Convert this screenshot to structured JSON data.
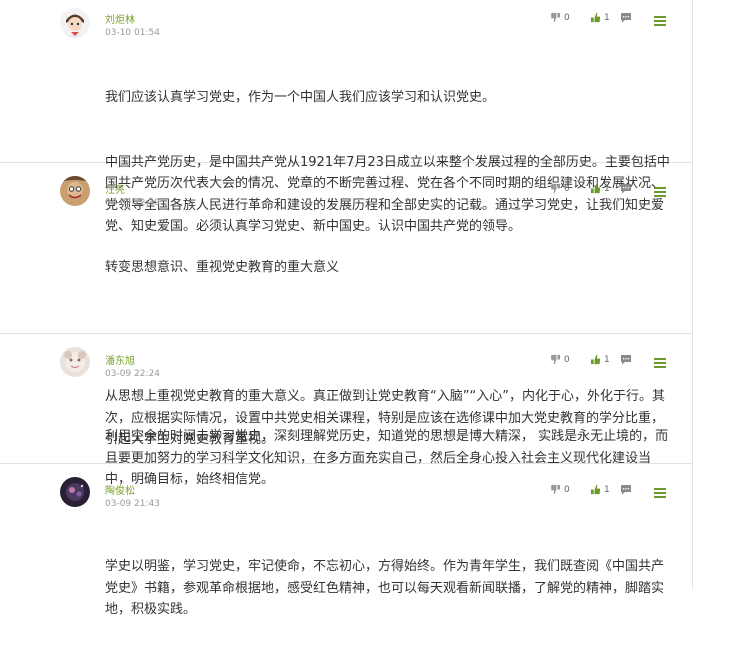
{
  "comments": [
    {
      "name": "刘炬林",
      "time": "03-10 01:54",
      "dislikes": "0",
      "likes": "1",
      "paragraphs": [
        "我们应该认真学习党史，作为一个中国人我们应该学习和认识党史。",
        "中国共产党历史，是中国共产党从1921年7月23日成立以来整个发展过程的全部历史。主要包括中国共产党历次代表大会的情况、党章的不断完善过程、党在各个不同时期的组织建设和发展状况、党领导全国各族人民进行革命和建设的发展历程和全部史实的记载。通过学习党史，让我们知史爱党、知史爱国。必须认真学习党史、新中国史。认识中国共产党的领导。"
      ]
    },
    {
      "name": "汪亮",
      "time": "03-09 22:39",
      "dislikes": "0",
      "likes": "1",
      "paragraphs": [
        "转变思想意识、重视党史教育的重大意义",
        "",
        "从思想上重视党史教育的重大意义。真正做到让党史教育“入脑”“入心”，内化于心，外化于行。其次，应根据实际情况，设置中共党史相关课程，特别是应该在选修课中加大党史教育的学分比重，引起大学生对党史教育重视。"
      ]
    },
    {
      "name": "潘东旭",
      "time": "03-09 22:24",
      "dislikes": "0",
      "likes": "1",
      "paragraphs": [
        "利用空余的时间去学习党史，深刻理解党历史，知道党的思想是博大精深， 实践是永无止境的，而且要更加努力的学习科学文化知识，在多方面充实自己，然后全身心投入社会主义现代化建设当中，明确目标，始终相信党。"
      ]
    },
    {
      "name": "陶俊松",
      "time": "03-09 21:43",
      "dislikes": "0",
      "likes": "1",
      "paragraphs": [
        "学史以明鉴，学习党史，牢记使命，不忘初心，方得始终。作为青年学生，我们既查阅《中国共产党史》书籍，参观革命根据地，感受红色精神，也可以每天观看新闻联播，了解党的精神，脚踏实地，积极实践。"
      ]
    }
  ],
  "icons": {
    "dislike": "thumb-down-icon",
    "like": "thumb-up-icon",
    "reply": "chat-bubble-icon",
    "menu": "hamburger-menu-icon"
  },
  "colors": {
    "username": "#7aa32a",
    "like_icon": "#6a9a2a",
    "menu_icon": "#6a9a2a",
    "divider": "#e2e2e2"
  }
}
